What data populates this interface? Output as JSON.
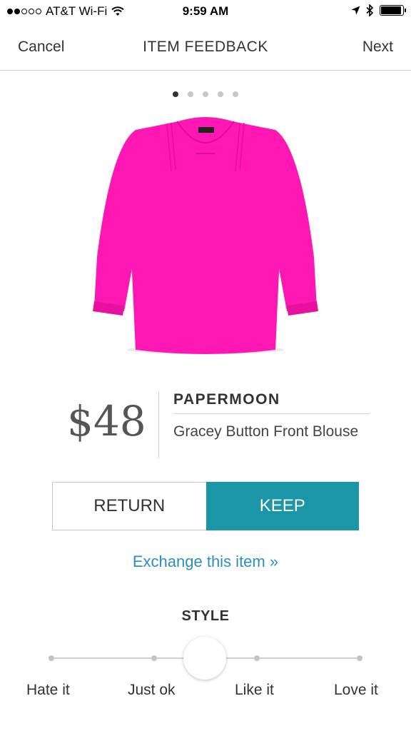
{
  "status_bar": {
    "carrier": "AT&T Wi-Fi",
    "time": "9:59 AM",
    "signal_bars_filled": 2,
    "signal_bars_total": 5,
    "battery_level": 0.95,
    "icons": [
      "wifi-icon",
      "location-arrow-icon",
      "bluetooth-icon",
      "battery-icon"
    ]
  },
  "nav": {
    "cancel": "Cancel",
    "title": "ITEM FEEDBACK",
    "next": "Next"
  },
  "pager": {
    "count": 5,
    "active_index": 0
  },
  "product": {
    "price": "$48",
    "brand": "PAPERMOON",
    "name": "Gracey Button Front Blouse",
    "image_color": "#ff17b4"
  },
  "actions": {
    "return_label": "RETURN",
    "keep_label": "KEEP",
    "keep_color": "#1a96a6",
    "exchange_link": "Exchange this item »",
    "link_color": "#2a8fc0"
  },
  "style_rating": {
    "title": "STYLE",
    "options": [
      "Hate it",
      "Just ok",
      "Like it",
      "Love it"
    ],
    "selected_position": 0.5
  }
}
